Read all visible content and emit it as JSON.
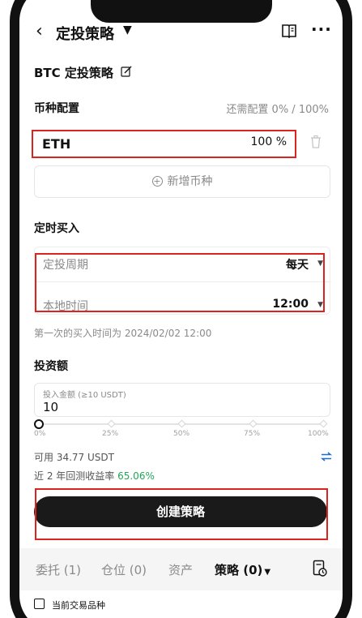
{
  "header": {
    "back_icon": "chevron-left-icon",
    "title": "定投策略",
    "caret": "▼",
    "book_icon": "book-icon",
    "more": "···"
  },
  "strategy": {
    "name": "BTC 定投策略"
  },
  "coin_config": {
    "title": "币种配置",
    "remaining": "还需配置 0% / 100%",
    "coins": [
      {
        "name": "ETH",
        "percent": "100 %"
      }
    ],
    "add_label": "新增币种"
  },
  "schedule": {
    "title": "定时买入",
    "period_label": "定投周期",
    "period_value": "每天",
    "time_label": "本地时间",
    "time_value": "12:00",
    "first_buy_note": "第一次的买入时间为 2024/02/02 12:00"
  },
  "investment": {
    "title": "投资额",
    "input_label": "投入金额 (≥10 USDT)",
    "input_value": "10",
    "slider_fraction": 0,
    "slider_ticks": [
      "0%",
      "25%",
      "50%",
      "75%",
      "100%"
    ],
    "available": "可用 34.77 USDT",
    "backtest_label": "近 2 年回测收益率",
    "backtest_value": "65.06%"
  },
  "create_button": "创建策略",
  "tabs": [
    {
      "label": "委托 (1)",
      "active": false
    },
    {
      "label": "仓位 (0)",
      "active": false
    },
    {
      "label": "资产",
      "active": false
    },
    {
      "label": "策略 (0)",
      "active": true
    }
  ],
  "bottom": {
    "checkbox_label": "当前交易品种"
  },
  "colors": {
    "highlight": "#d9251d",
    "positive": "#21a65a",
    "button": "#1a1a1a",
    "link": "#1a6fd1"
  }
}
